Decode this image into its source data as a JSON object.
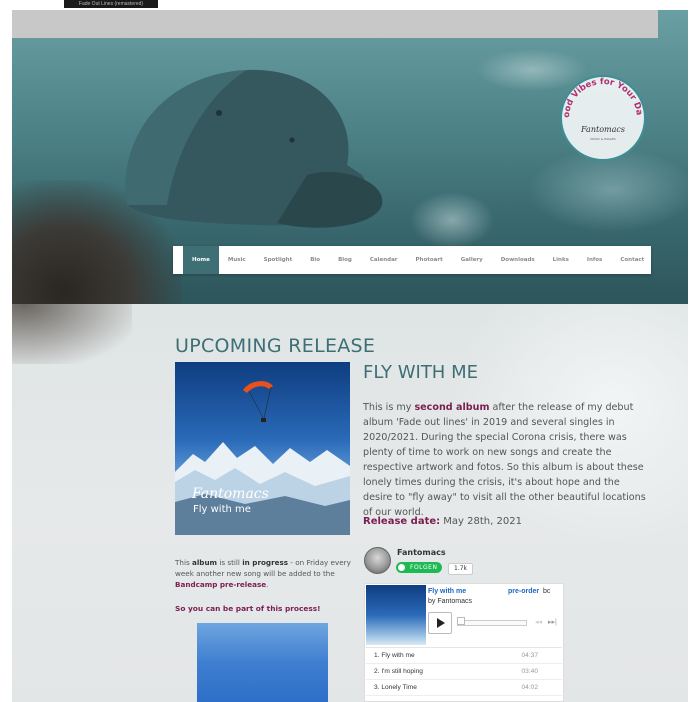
{
  "top": {
    "logo_text": "Fade Out Lines (remastered)"
  },
  "hero": {
    "badge_text": "Good Vibes for Your Day!",
    "badge_brand": "Fantomacs",
    "badge_sub": "MUSIC & IMAGES"
  },
  "nav": {
    "items": [
      "Home",
      "Music",
      "Spotlight",
      "Bio",
      "Blog",
      "Calendar",
      "Photoart",
      "Gallery",
      "Downloads",
      "Links",
      "Infos",
      "Contact"
    ],
    "active": "Home"
  },
  "upcoming": {
    "heading": "UPCOMING RELEASE",
    "cover_title": "Fantomacs",
    "cover_subtitle": "Fly with me"
  },
  "album": {
    "title": "FLY WITH ME",
    "desc_1": "This is my ",
    "desc_bold": "second album",
    "desc_2": " after the release of my debut album 'Fade out lines' in 2019 and several singles in 2020/2021. During the special Corona crisis, there was plenty of time to work on new songs and create the respective artwork and fotos. So this album is about these lonely times during the crisis, it's about hope and the desire to \"fly away\" to visit all the other beautiful locations of our world.",
    "release_label": "Release date:",
    "release_value": " May 28th, 2021"
  },
  "progress": {
    "t1": "This ",
    "b1": "album",
    "t2": " is still ",
    "b2": "in progress",
    "t3": " - on Friday every week another new song will be added to the ",
    "link": "Bandcamp pre-release",
    "t4": ".",
    "part": "So you can be part of this process!"
  },
  "spotify": {
    "name": "Fantomacs",
    "follow_label": "FOLGEN",
    "count": "1.7k"
  },
  "bandcamp": {
    "title": "Fly with me",
    "by": "by Fantomacs",
    "preorder": "pre-order",
    "logo": "bc",
    "tracks": [
      {
        "label": "1.  Fly with me",
        "time": "04:37"
      },
      {
        "label": "2.  I'm still hoping",
        "time": "03:40"
      },
      {
        "label": "3.  Lonely Time",
        "time": "04:02"
      }
    ]
  },
  "colors": {
    "accent_teal": "#3d6f75",
    "accent_purple": "#7a1d52",
    "spotify_green": "#1db954",
    "bandcamp_blue": "#1a66c2"
  }
}
